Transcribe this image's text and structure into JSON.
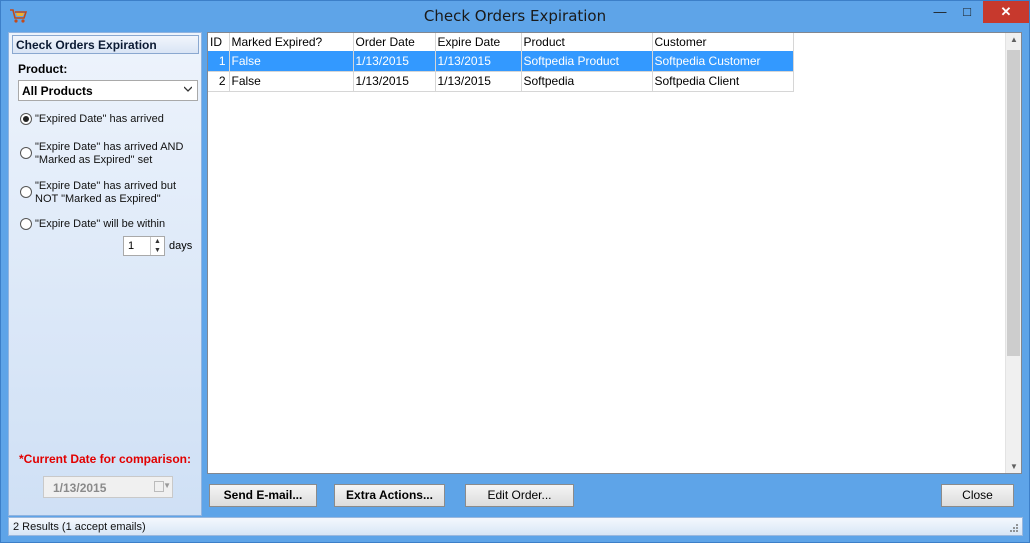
{
  "window": {
    "title": "Check Orders Expiration"
  },
  "left_panel": {
    "header": "Check Orders Expiration",
    "product_label": "Product:",
    "product_selected": "All Products",
    "radios": [
      {
        "line1": "\"Expired Date\" has arrived",
        "line2": "",
        "checked": true
      },
      {
        "line1": "\"Expire Date\" has arrived AND",
        "line2": "\"Marked as Expired\" set",
        "checked": false
      },
      {
        "line1": "\"Expire Date\" has arrived but",
        "line2": "NOT \"Marked as Expired\"",
        "checked": false
      },
      {
        "line1": "\"Expire Date\" will be within",
        "line2": "",
        "checked": false
      }
    ],
    "days_value": "1",
    "days_label": "days",
    "current_date_label": "*Current Date for comparison:",
    "current_date": "1/13/2015"
  },
  "grid": {
    "columns": [
      "ID",
      "Marked Expired?",
      "Order Date",
      "Expire Date",
      "Product",
      "Customer"
    ],
    "rows": [
      [
        "1",
        "False",
        "1/13/2015",
        "1/13/2015",
        "Softpedia Product",
        "Softpedia Customer"
      ],
      [
        "2",
        "False",
        "1/13/2015",
        "1/13/2015",
        "Softpedia",
        "Softpedia Client"
      ]
    ]
  },
  "buttons": {
    "send_email": "Send E-mail...",
    "extra_actions": "Extra Actions...",
    "edit_order": "Edit Order...",
    "close": "Close"
  },
  "status": {
    "text": "2 Results (1 accept emails)"
  },
  "colors": {
    "selection": "#3399ff",
    "frame": "#5ea4e8",
    "alert": "#e20000"
  }
}
